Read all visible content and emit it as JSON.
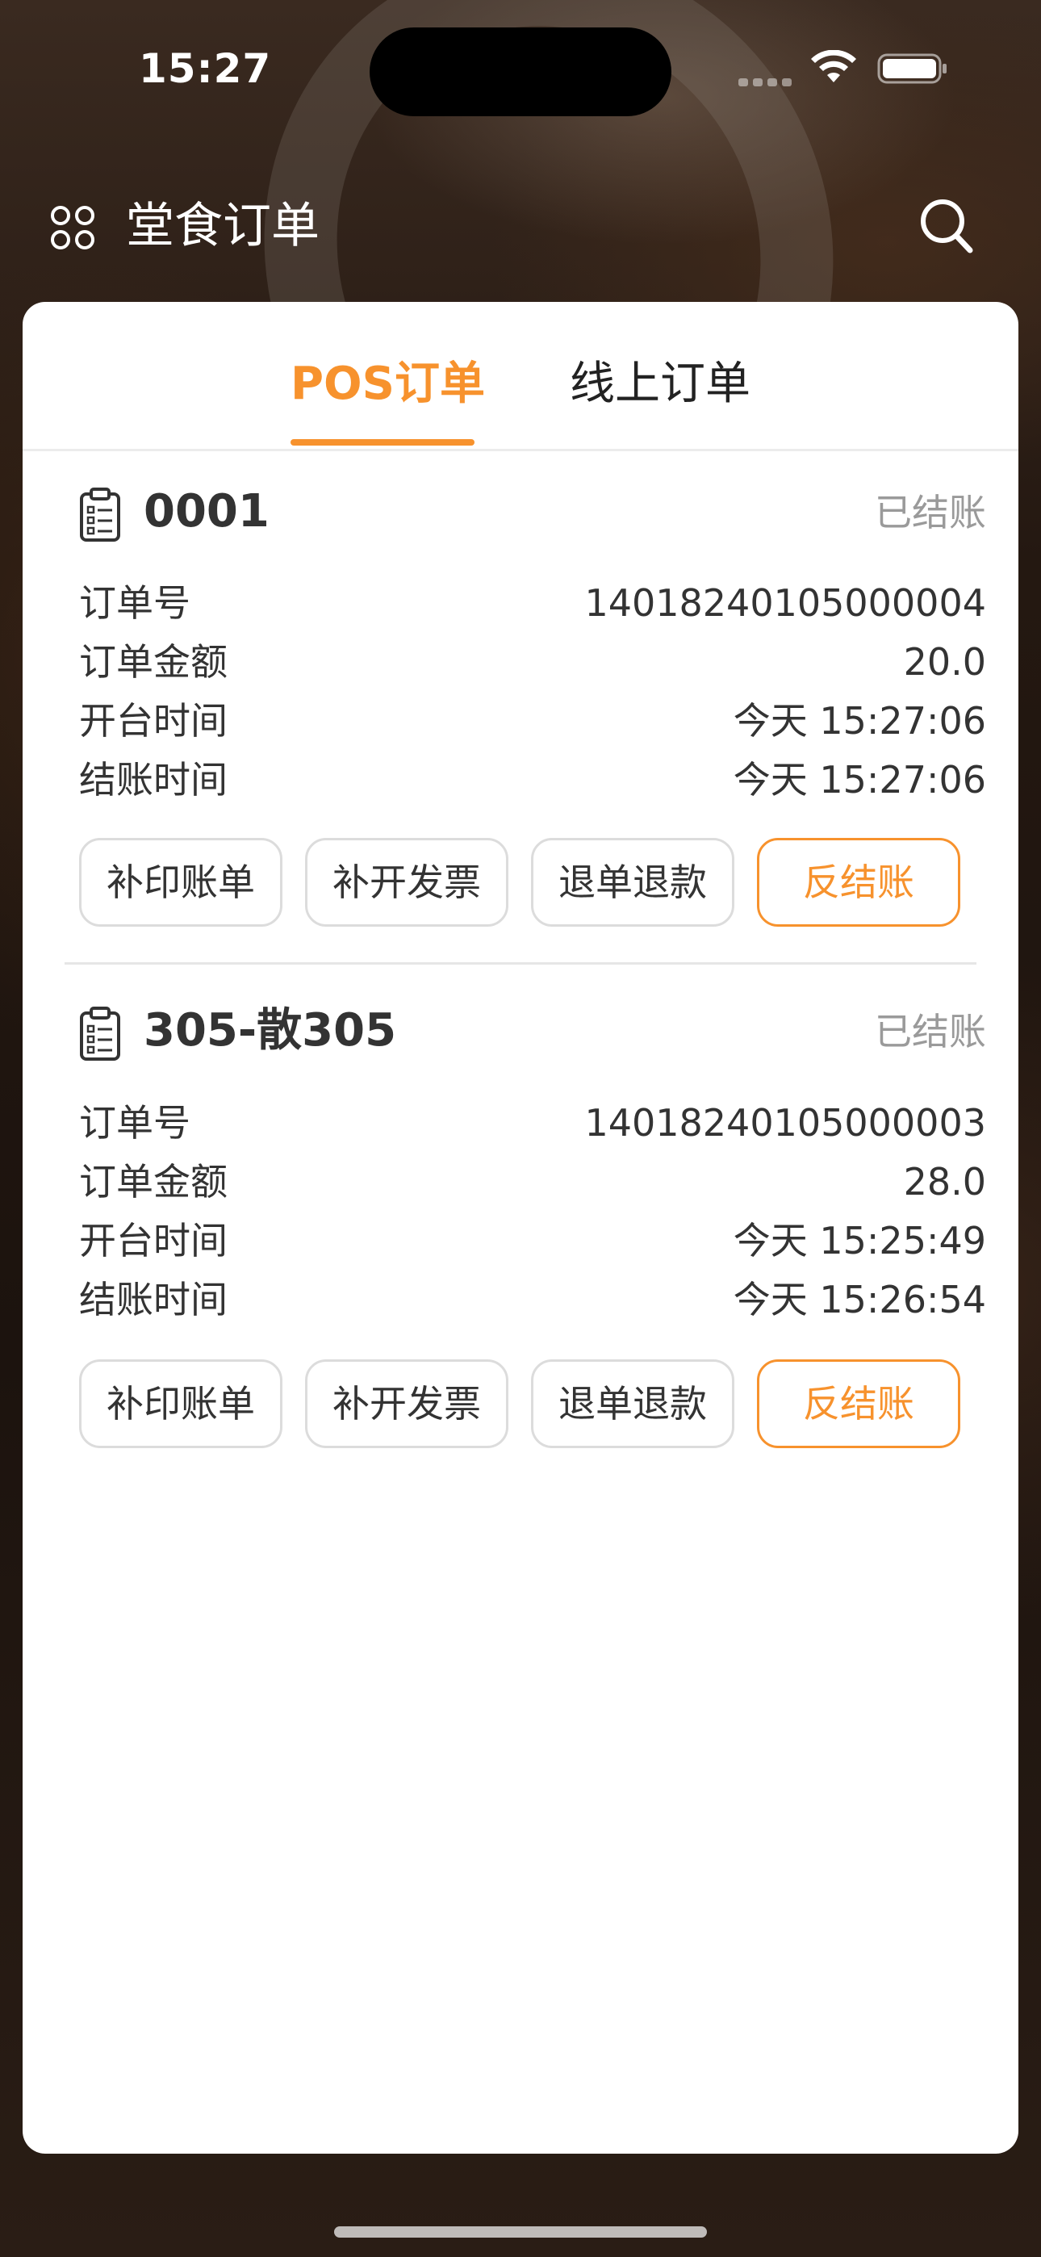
{
  "status_bar": {
    "time": "15:27",
    "icons": [
      "cellular-signal-icon",
      "wifi-icon",
      "battery-icon"
    ]
  },
  "nav": {
    "menu_icon": "grid-menu-icon",
    "title": "堂食订单",
    "search_icon": "search-icon"
  },
  "tabs": [
    {
      "label": "POS订单",
      "active": true
    },
    {
      "label": "线上订单",
      "active": false
    }
  ],
  "labels": {
    "order_no": "订单号",
    "amount": "订单金额",
    "open_time": "开台时间",
    "checkout_time": "结账时间"
  },
  "orders": [
    {
      "name": "0001",
      "status": "已结账",
      "order_no": "14018240105000004",
      "amount": "20.0",
      "open_time": "今天 15:27:06",
      "checkout_time": "今天 15:27:06",
      "buttons": [
        "补印账单",
        "补开发票",
        "退单退款",
        "反结账"
      ]
    },
    {
      "name": "305-散305",
      "status": "已结账",
      "order_no": "14018240105000003",
      "amount": "28.0",
      "open_time": "今天 15:25:49",
      "checkout_time": "今天 15:26:54",
      "buttons": [
        "补印账单",
        "补开发票",
        "退单退款",
        "反结账"
      ]
    }
  ],
  "colors": {
    "accent": "#f7922d",
    "status_gray": "#9a9a9a",
    "text": "#333333"
  }
}
